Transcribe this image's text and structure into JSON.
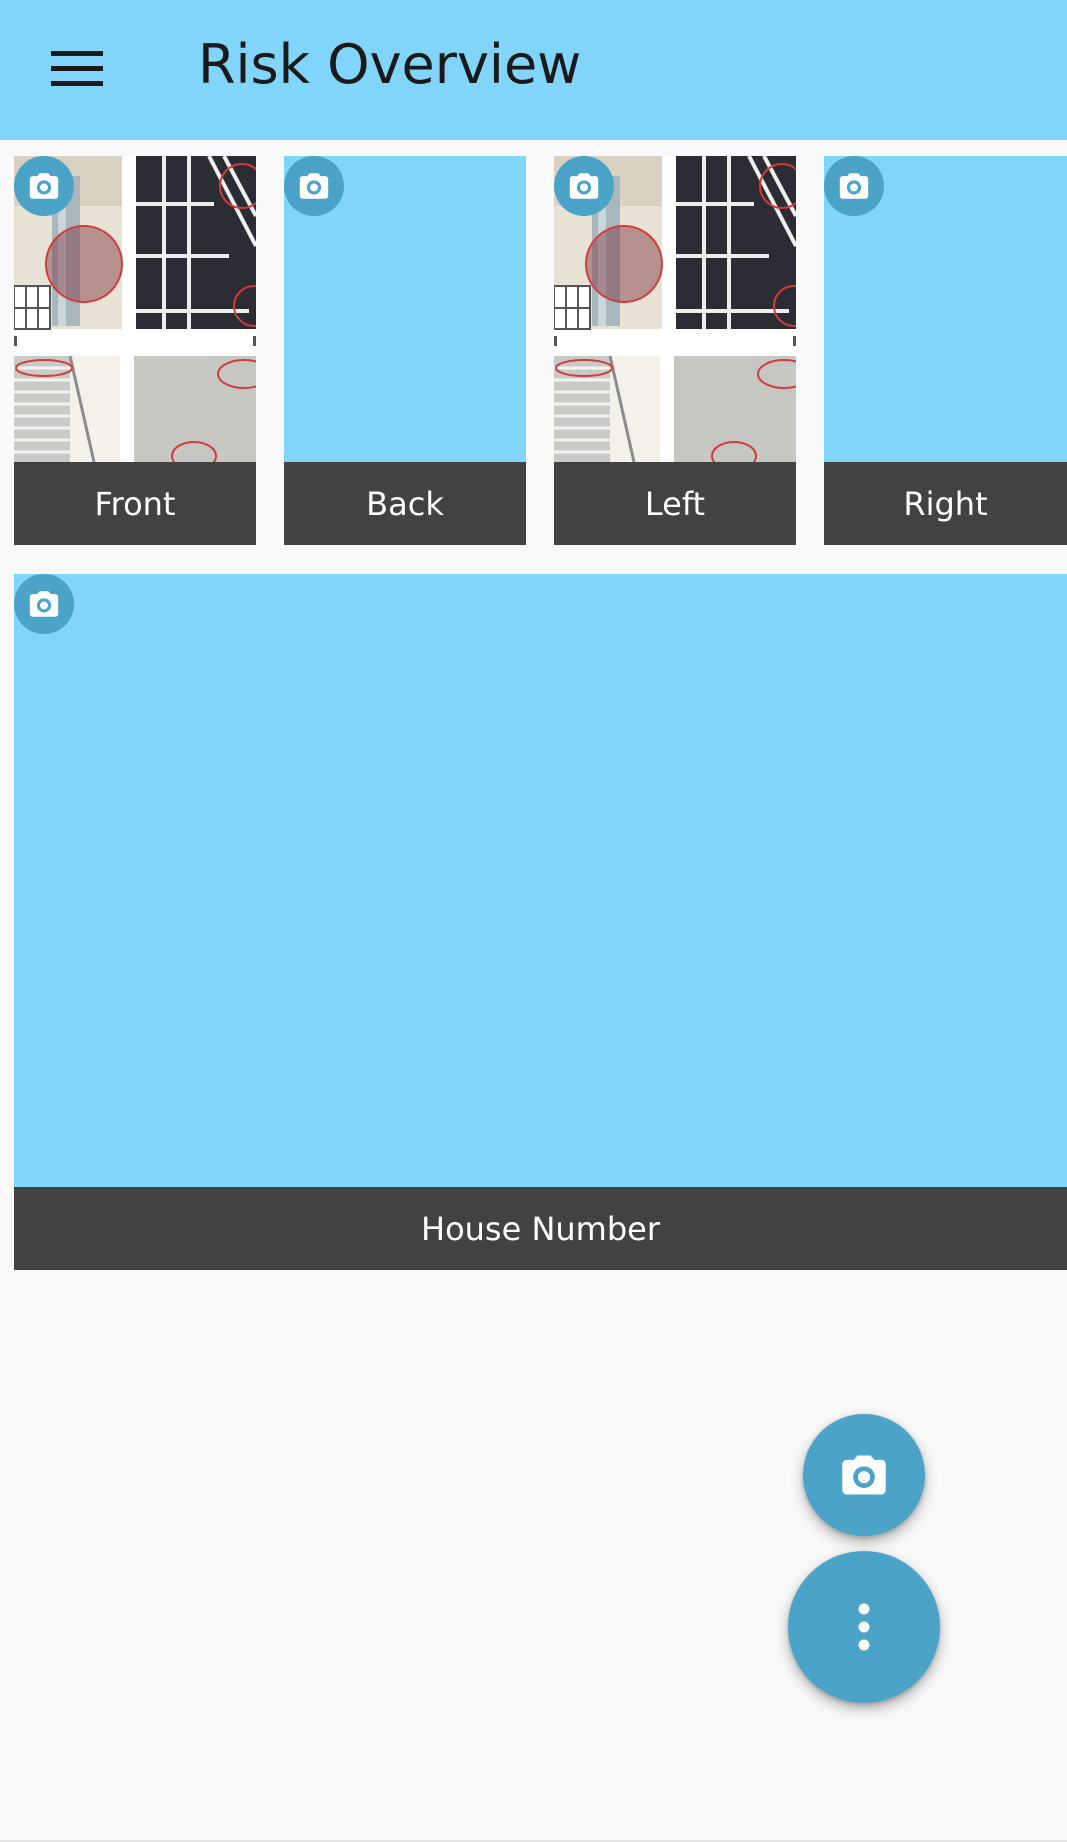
{
  "appbar": {
    "title": "Risk Overview",
    "menu_icon": "hamburger-menu-icon",
    "background": "#81d4fa"
  },
  "tiles": [
    {
      "label": "Front",
      "has_photo": true
    },
    {
      "label": "Back",
      "has_photo": false
    },
    {
      "label": "Left",
      "has_photo": true
    },
    {
      "label": "Right",
      "has_photo": false
    }
  ],
  "wide_tile": {
    "label": "House Number",
    "has_photo": false
  },
  "tile_icon": "camera-icon",
  "fabs": {
    "camera_icon": "camera-icon",
    "more_icon": "more-vertical-icon"
  },
  "colors": {
    "accent": "#4ba3c7",
    "placeholder": "#81d4fa",
    "caption_bar": "#424242",
    "background": "#f9f9f9"
  }
}
